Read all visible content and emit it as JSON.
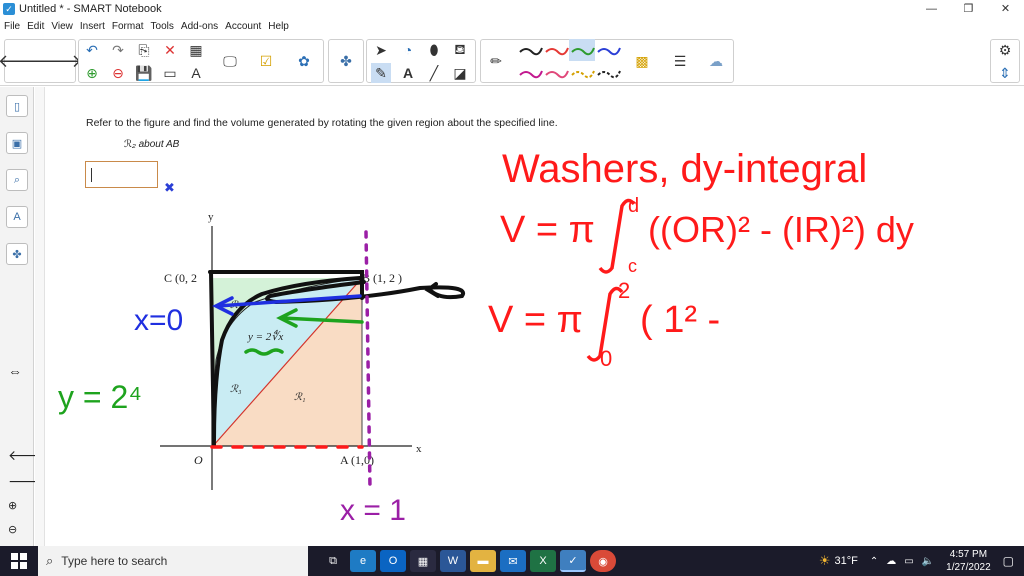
{
  "window": {
    "title": "Untitled * - SMART Notebook",
    "minimize": "—",
    "restore": "❐",
    "close": "✕"
  },
  "menu": [
    "File",
    "Edit",
    "View",
    "Insert",
    "Format",
    "Tools",
    "Add-ons",
    "Account",
    "Help"
  ],
  "toolbar": {
    "icons": [
      "back-arrow-icon",
      "forward-arrow-icon",
      "undo-icon",
      "redo-icon",
      "paste-icon",
      "delete-icon",
      "table-icon",
      "screen-shade-icon",
      "check-icon",
      "addon-icon",
      "puzzle-icon",
      "select-arrow-icon",
      "pen-icon",
      "eraser-icon",
      "fill-icon",
      "settings-gear-icon"
    ],
    "pen_colors": [
      "#222222",
      "#e53935",
      "#2e9b2e",
      "#2b3fd6",
      "#c2188f",
      "#e0487a",
      "#d4a000",
      "#222222"
    ],
    "active_pen_color": "#2e9b2e",
    "text_tool_label": "A"
  },
  "problem": {
    "instruction": "Refer to the figure and find the volume generated by rotating the given region about the specified line.",
    "sub_label": "ℛ₂ about AB",
    "feedback_mark": "✖"
  },
  "figure": {
    "y_axis": "y",
    "x_axis": "x",
    "point_c": "C (0, 2",
    "point_b": "B (1, 2 )",
    "point_o": "O",
    "point_a": "A (1,0)",
    "curve_label": "y = 2∜x",
    "region_r1": "ℛ₁",
    "region_r2": "ℛ₂",
    "region_r3": "ℛ₃",
    "colors": {
      "r1": "#f9dcc4",
      "r2": "#d4f2d8",
      "r3": "#c9ecf3"
    }
  },
  "handwriting": {
    "line1": "Washers, dy-integral",
    "line2_prefix": "V = π",
    "line2_body": "((OR)² - (IR)²) dy",
    "int_upper1": "d",
    "int_lower1": "c",
    "line3_prefix": "V = π",
    "line3_body": "( 1² -",
    "int_upper2": "2",
    "int_lower2": "0",
    "x_eq_0": "x=0",
    "y_eq": "y = 2⁴",
    "x_eq_1": "x = 1",
    "colors": {
      "red": "#ff1a1a",
      "green": "#1ea31e",
      "blue": "#1f2fe0",
      "purple": "#9b1fa6"
    }
  },
  "taskbar": {
    "search_placeholder": "Type here to search",
    "weather": "31°F",
    "time": "4:57 PM",
    "date": "1/27/2022",
    "apps": [
      "task-view-icon",
      "edge-icon",
      "outlook-icon",
      "store-icon",
      "word-icon",
      "file-explorer-icon",
      "mail-icon",
      "excel-icon",
      "smart-notebook-icon",
      "chrome-icon"
    ]
  }
}
